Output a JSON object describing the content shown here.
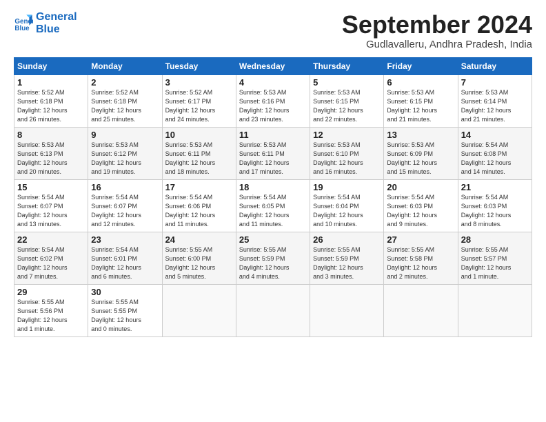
{
  "header": {
    "logo_line1": "General",
    "logo_line2": "Blue",
    "month": "September 2024",
    "location": "Gudlavalleru, Andhra Pradesh, India"
  },
  "weekdays": [
    "Sunday",
    "Monday",
    "Tuesday",
    "Wednesday",
    "Thursday",
    "Friday",
    "Saturday"
  ],
  "weeks": [
    [
      {
        "day": "1",
        "info": "Sunrise: 5:52 AM\nSunset: 6:18 PM\nDaylight: 12 hours\nand 26 minutes."
      },
      {
        "day": "2",
        "info": "Sunrise: 5:52 AM\nSunset: 6:18 PM\nDaylight: 12 hours\nand 25 minutes."
      },
      {
        "day": "3",
        "info": "Sunrise: 5:52 AM\nSunset: 6:17 PM\nDaylight: 12 hours\nand 24 minutes."
      },
      {
        "day": "4",
        "info": "Sunrise: 5:53 AM\nSunset: 6:16 PM\nDaylight: 12 hours\nand 23 minutes."
      },
      {
        "day": "5",
        "info": "Sunrise: 5:53 AM\nSunset: 6:15 PM\nDaylight: 12 hours\nand 22 minutes."
      },
      {
        "day": "6",
        "info": "Sunrise: 5:53 AM\nSunset: 6:15 PM\nDaylight: 12 hours\nand 21 minutes."
      },
      {
        "day": "7",
        "info": "Sunrise: 5:53 AM\nSunset: 6:14 PM\nDaylight: 12 hours\nand 21 minutes."
      }
    ],
    [
      {
        "day": "8",
        "info": "Sunrise: 5:53 AM\nSunset: 6:13 PM\nDaylight: 12 hours\nand 20 minutes."
      },
      {
        "day": "9",
        "info": "Sunrise: 5:53 AM\nSunset: 6:12 PM\nDaylight: 12 hours\nand 19 minutes."
      },
      {
        "day": "10",
        "info": "Sunrise: 5:53 AM\nSunset: 6:11 PM\nDaylight: 12 hours\nand 18 minutes."
      },
      {
        "day": "11",
        "info": "Sunrise: 5:53 AM\nSunset: 6:11 PM\nDaylight: 12 hours\nand 17 minutes."
      },
      {
        "day": "12",
        "info": "Sunrise: 5:53 AM\nSunset: 6:10 PM\nDaylight: 12 hours\nand 16 minutes."
      },
      {
        "day": "13",
        "info": "Sunrise: 5:53 AM\nSunset: 6:09 PM\nDaylight: 12 hours\nand 15 minutes."
      },
      {
        "day": "14",
        "info": "Sunrise: 5:54 AM\nSunset: 6:08 PM\nDaylight: 12 hours\nand 14 minutes."
      }
    ],
    [
      {
        "day": "15",
        "info": "Sunrise: 5:54 AM\nSunset: 6:07 PM\nDaylight: 12 hours\nand 13 minutes."
      },
      {
        "day": "16",
        "info": "Sunrise: 5:54 AM\nSunset: 6:07 PM\nDaylight: 12 hours\nand 12 minutes."
      },
      {
        "day": "17",
        "info": "Sunrise: 5:54 AM\nSunset: 6:06 PM\nDaylight: 12 hours\nand 11 minutes."
      },
      {
        "day": "18",
        "info": "Sunrise: 5:54 AM\nSunset: 6:05 PM\nDaylight: 12 hours\nand 11 minutes."
      },
      {
        "day": "19",
        "info": "Sunrise: 5:54 AM\nSunset: 6:04 PM\nDaylight: 12 hours\nand 10 minutes."
      },
      {
        "day": "20",
        "info": "Sunrise: 5:54 AM\nSunset: 6:03 PM\nDaylight: 12 hours\nand 9 minutes."
      },
      {
        "day": "21",
        "info": "Sunrise: 5:54 AM\nSunset: 6:03 PM\nDaylight: 12 hours\nand 8 minutes."
      }
    ],
    [
      {
        "day": "22",
        "info": "Sunrise: 5:54 AM\nSunset: 6:02 PM\nDaylight: 12 hours\nand 7 minutes."
      },
      {
        "day": "23",
        "info": "Sunrise: 5:54 AM\nSunset: 6:01 PM\nDaylight: 12 hours\nand 6 minutes."
      },
      {
        "day": "24",
        "info": "Sunrise: 5:55 AM\nSunset: 6:00 PM\nDaylight: 12 hours\nand 5 minutes."
      },
      {
        "day": "25",
        "info": "Sunrise: 5:55 AM\nSunset: 5:59 PM\nDaylight: 12 hours\nand 4 minutes."
      },
      {
        "day": "26",
        "info": "Sunrise: 5:55 AM\nSunset: 5:59 PM\nDaylight: 12 hours\nand 3 minutes."
      },
      {
        "day": "27",
        "info": "Sunrise: 5:55 AM\nSunset: 5:58 PM\nDaylight: 12 hours\nand 2 minutes."
      },
      {
        "day": "28",
        "info": "Sunrise: 5:55 AM\nSunset: 5:57 PM\nDaylight: 12 hours\nand 1 minute."
      }
    ],
    [
      {
        "day": "29",
        "info": "Sunrise: 5:55 AM\nSunset: 5:56 PM\nDaylight: 12 hours\nand 1 minute."
      },
      {
        "day": "30",
        "info": "Sunrise: 5:55 AM\nSunset: 5:55 PM\nDaylight: 12 hours\nand 0 minutes."
      },
      {
        "day": "",
        "info": ""
      },
      {
        "day": "",
        "info": ""
      },
      {
        "day": "",
        "info": ""
      },
      {
        "day": "",
        "info": ""
      },
      {
        "day": "",
        "info": ""
      }
    ]
  ]
}
